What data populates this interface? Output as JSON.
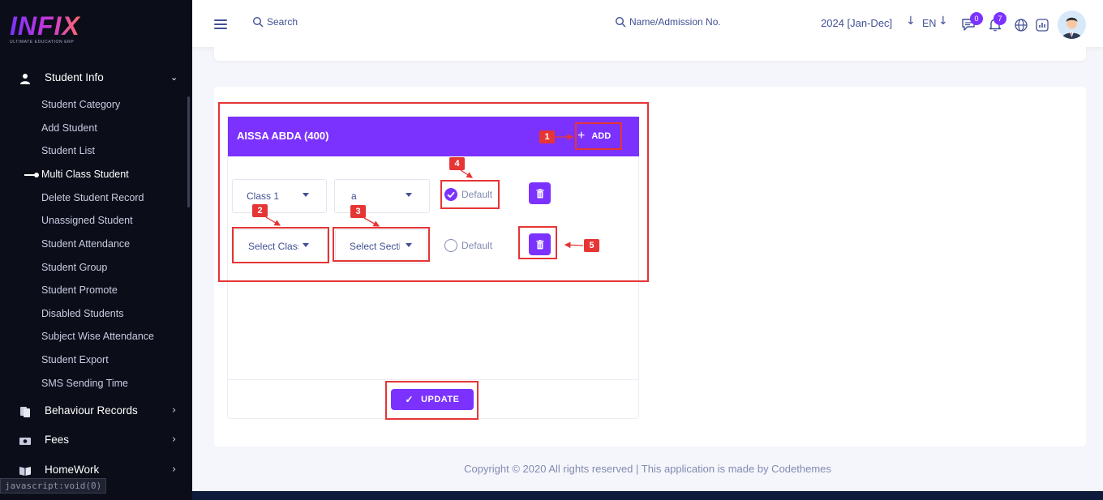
{
  "brand": {
    "name": "INFIX",
    "tagline": "ULTIMATE EDUCATION ERP"
  },
  "sidebar": {
    "section": {
      "label": "Student Info",
      "icon": "user-icon"
    },
    "items": [
      {
        "label": "Student Category"
      },
      {
        "label": "Add Student"
      },
      {
        "label": "Student List"
      },
      {
        "label": "Multi Class Student",
        "active": true
      },
      {
        "label": "Delete Student Record"
      },
      {
        "label": "Unassigned Student"
      },
      {
        "label": "Student Attendance"
      },
      {
        "label": "Student Group"
      },
      {
        "label": "Student Promote"
      },
      {
        "label": "Disabled Students"
      },
      {
        "label": "Subject Wise Attendance"
      },
      {
        "label": "Student Export"
      },
      {
        "label": "SMS Sending Time"
      }
    ],
    "main": [
      {
        "label": "Behaviour Records",
        "icon": "clipboard-icon"
      },
      {
        "label": "Fees",
        "icon": "money-icon"
      },
      {
        "label": "HomeWork",
        "icon": "book-icon"
      }
    ]
  },
  "status_tip": "javascript:void(0)",
  "topbar": {
    "search_label": "Search",
    "search2_label": "Name/Admission No.",
    "year": "2024 [Jan-Dec]",
    "lang": "EN",
    "messages_count": "0",
    "notifications_count": "7"
  },
  "card": {
    "title": "AISSA ABDA (400)",
    "add_label": "ADD",
    "rows": [
      {
        "class": "Class 1",
        "section": "a",
        "default_label": "Default",
        "default_on": true
      },
      {
        "class": "Select Class",
        "section": "Select Section",
        "default_label": "Default",
        "default_on": false
      }
    ],
    "update_label": "UPDATE"
  },
  "annotations": [
    "1",
    "2",
    "3",
    "4",
    "5"
  ],
  "footer": "Copyright © 2020 All rights reserved | This application is made by Codethemes",
  "colors": {
    "accent": "#7c32ff",
    "sidebar": "#0b0e19",
    "annotation": "#e53535",
    "text": "#415094"
  }
}
